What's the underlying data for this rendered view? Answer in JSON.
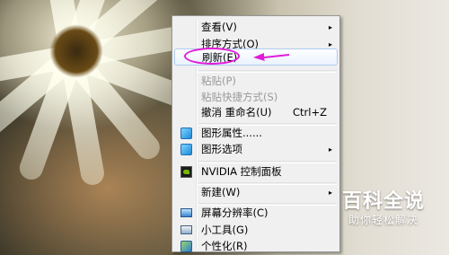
{
  "context_menu": {
    "items": [
      {
        "label": "查看(V)",
        "has_submenu": true
      },
      {
        "label": "排序方式(O)",
        "has_submenu": true
      },
      {
        "label": "刷新(E)",
        "highlighted": true
      },
      {
        "label": "粘贴(P)",
        "disabled": true
      },
      {
        "label": "粘贴快捷方式(S)",
        "disabled": true
      },
      {
        "label": "撤消 重命名(U)",
        "shortcut": "Ctrl+Z"
      },
      {
        "label": "图形属性......",
        "icon": "graphics-properties-icon"
      },
      {
        "label": "图形选项",
        "icon": "graphics-options-icon",
        "has_submenu": true
      },
      {
        "label": "NVIDIA 控制面板",
        "icon": "nvidia-icon"
      },
      {
        "label": "新建(W)",
        "has_submenu": true
      },
      {
        "label": "屏幕分辨率(C)",
        "icon": "screen-resolution-icon"
      },
      {
        "label": "小工具(G)",
        "icon": "gadgets-icon"
      },
      {
        "label": "个性化(R)",
        "icon": "personalize-icon"
      }
    ],
    "submenu_arrow": "▸"
  },
  "annotation": {
    "color": "#e21ad9"
  },
  "watermark": {
    "title": "百科全说",
    "subtitle": "助你轻松解决"
  }
}
